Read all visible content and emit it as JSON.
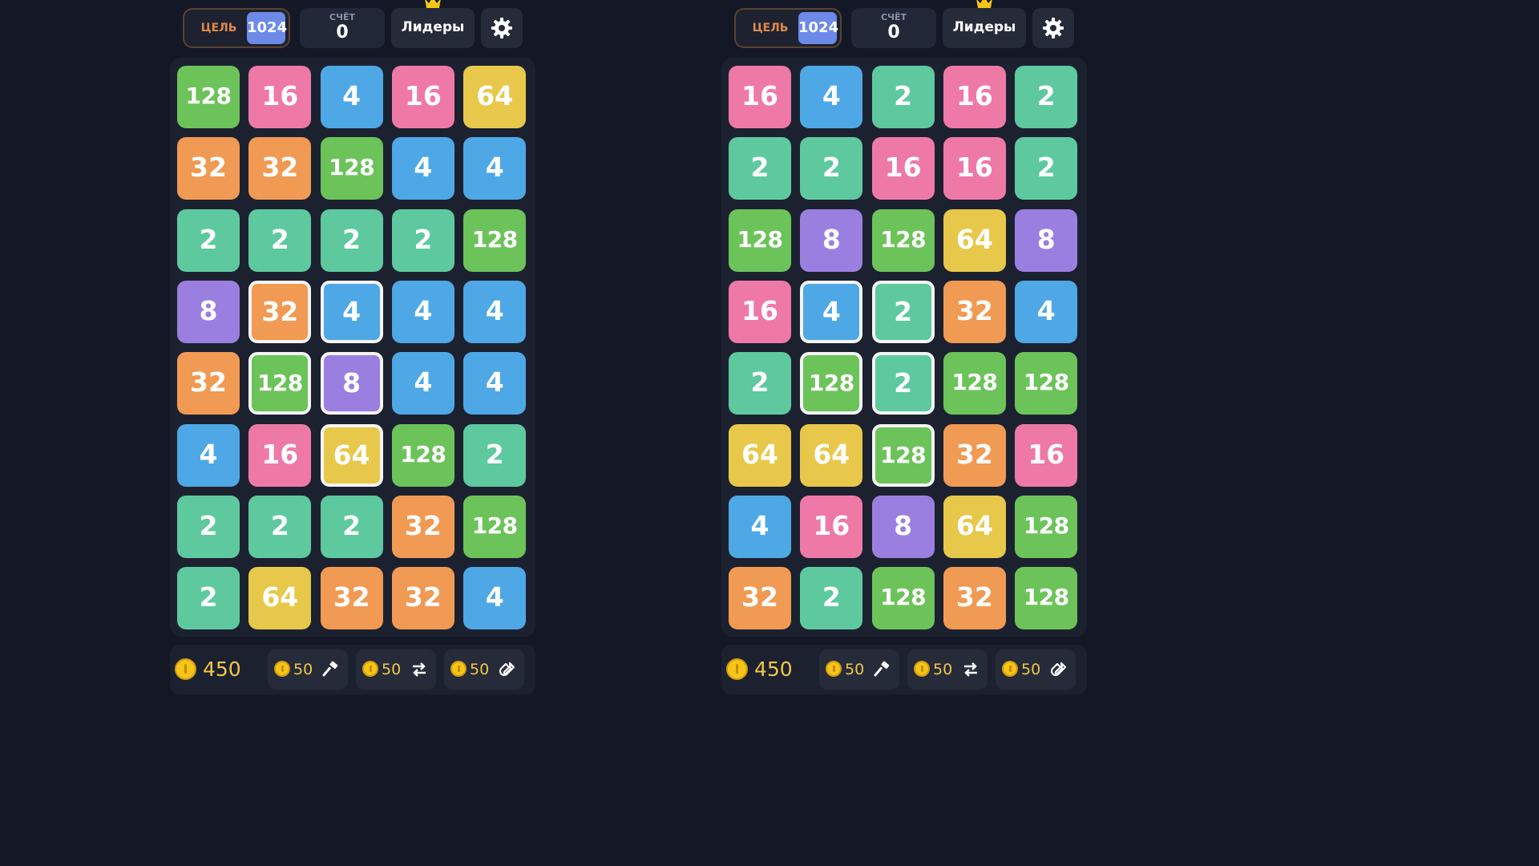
{
  "colors": {
    "2": "#5ec99f",
    "4": "#4ea8e6",
    "8": "#9b7fe0",
    "16": "#ee79a7",
    "32": "#f19a53",
    "64": "#e8c84a",
    "128": "#6cc35a",
    "goal": "#6d8ae8"
  },
  "icons": [
    "crown-icon",
    "gear-icon",
    "coin-icon",
    "hammer-icon",
    "swap-icon",
    "magnet-icon"
  ],
  "boards": [
    {
      "header": {
        "goal_label": "ЦЕЛЬ",
        "goal_value": "1024",
        "score_label": "СЧЁТ",
        "score_value": "0",
        "leaders_label": "Лидеры"
      },
      "grid": [
        [
          "128",
          "16",
          "4",
          "16",
          "64"
        ],
        [
          "32",
          "32",
          "128",
          "4",
          "4"
        ],
        [
          "2",
          "2",
          "2",
          "2",
          "128"
        ],
        [
          "8",
          "32",
          "4",
          "4",
          "4"
        ],
        [
          "32",
          "128",
          "8",
          "4",
          "4"
        ],
        [
          "4",
          "16",
          "64",
          "128",
          "2"
        ],
        [
          "2",
          "2",
          "2",
          "32",
          "128"
        ],
        [
          "2",
          "64",
          "32",
          "32",
          "4"
        ]
      ],
      "selected": [
        [
          3,
          1
        ],
        [
          3,
          2
        ],
        [
          4,
          1
        ],
        [
          4,
          2
        ],
        [
          5,
          2
        ]
      ],
      "footer": {
        "balance": "450",
        "boosters": [
          {
            "cost": "50",
            "icon": "hammer-icon"
          },
          {
            "cost": "50",
            "icon": "swap-icon"
          },
          {
            "cost": "50",
            "icon": "magnet-icon"
          }
        ]
      }
    },
    {
      "header": {
        "goal_label": "ЦЕЛЬ",
        "goal_value": "1024",
        "score_label": "СЧЁТ",
        "score_value": "0",
        "leaders_label": "Лидеры"
      },
      "grid": [
        [
          "16",
          "4",
          "2",
          "16",
          "2"
        ],
        [
          "2",
          "2",
          "16",
          "16",
          "2"
        ],
        [
          "128",
          "8",
          "128",
          "64",
          "8"
        ],
        [
          "16",
          "4",
          "2",
          "32",
          "4"
        ],
        [
          "2",
          "128",
          "2",
          "128",
          "128"
        ],
        [
          "64",
          "64",
          "128",
          "32",
          "16"
        ],
        [
          "4",
          "16",
          "8",
          "64",
          "128"
        ],
        [
          "32",
          "2",
          "128",
          "32",
          "128"
        ]
      ],
      "selected": [
        [
          3,
          1
        ],
        [
          3,
          2
        ],
        [
          4,
          1
        ],
        [
          4,
          2
        ],
        [
          5,
          2
        ]
      ],
      "footer": {
        "balance": "450",
        "boosters": [
          {
            "cost": "50",
            "icon": "hammer-icon"
          },
          {
            "cost": "50",
            "icon": "swap-icon"
          },
          {
            "cost": "50",
            "icon": "magnet-icon"
          }
        ]
      }
    }
  ]
}
